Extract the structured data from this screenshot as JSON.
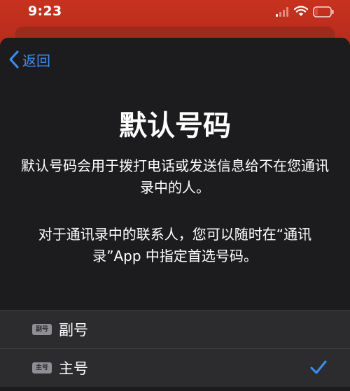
{
  "status_bar": {
    "time": "9:23"
  },
  "nav": {
    "back_label": "返回"
  },
  "title": "默认号码",
  "description_1": "默认号码会用于拨打电话或发送信息给不在您通讯录中的人。",
  "description_2": "对于通讯录中的联系人，您可以随时在“通讯录”App 中指定首选号码。",
  "options": [
    {
      "badge": "副号",
      "label": "副号",
      "selected": false
    },
    {
      "badge": "主号",
      "label": "主号",
      "selected": true
    }
  ],
  "colors": {
    "accent": "#3b8ef5",
    "backdrop": "#c7321f",
    "sheet": "#1c1c1e",
    "battery_low": "#e8453c"
  },
  "icons": {
    "back": "chevron-left-icon",
    "signal": "cellular-signal-icon",
    "wifi": "wifi-icon",
    "battery": "battery-icon",
    "check": "checkmark-icon"
  }
}
